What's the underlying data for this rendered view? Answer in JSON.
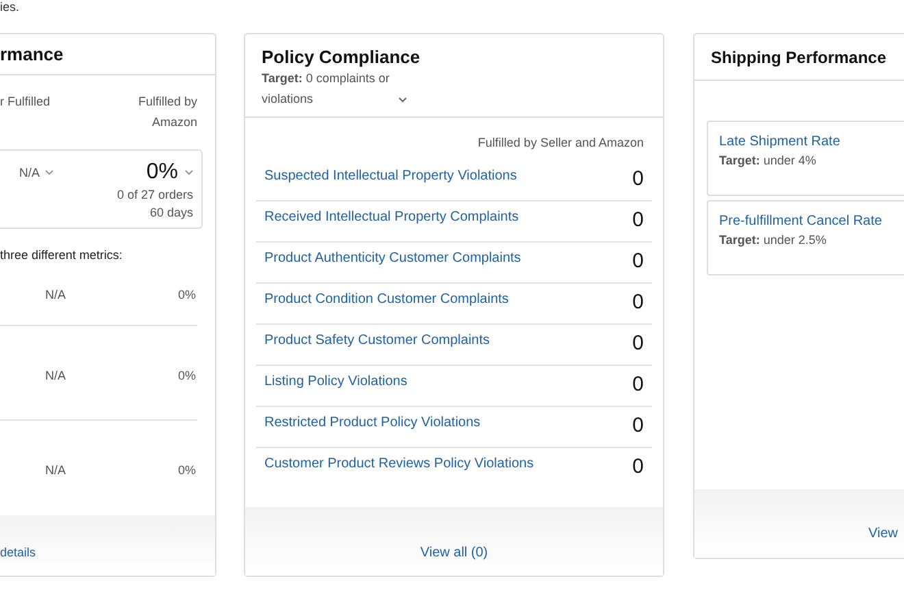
{
  "intro_text": "ies.",
  "fulfillment_card": {
    "title": "rmance",
    "columns": [
      "r Fulfilled",
      "Fulfilled by Amazon"
    ],
    "summary": {
      "seller_value": "N/A",
      "amazon_value": "0%",
      "orders": "0 of 27 orders",
      "period": "60 days"
    },
    "note": "three different metrics:",
    "rows": [
      {
        "seller_value": "N/A",
        "amazon_value": "0%"
      },
      {
        "seller_value": "N/A",
        "amazon_value": "0%"
      },
      {
        "seller_value": "N/A",
        "amazon_value": "0%"
      }
    ],
    "footer_link": "details"
  },
  "policy_card": {
    "title": "Policy Compliance",
    "target": "**Target:** 0 complaints or violations",
    "column": "Fulfilled by Seller and Amazon",
    "rows": [
      {
        "label": "Suspected Intellectual Property Violations",
        "value": "0"
      },
      {
        "label": "Received Intellectual Property Complaints",
        "value": "0"
      },
      {
        "label": "Product Authenticity Customer Complaints",
        "value": "0"
      },
      {
        "label": "Product Condition Customer Complaints",
        "value": "0"
      },
      {
        "label": "Product Safety Customer Complaints",
        "value": "0"
      },
      {
        "label": "Listing Policy Violations",
        "value": "0"
      },
      {
        "label": "Restricted Product Policy Violations",
        "value": "0"
      },
      {
        "label": "Customer Product Reviews Policy Violations",
        "value": "0"
      }
    ],
    "footer_link": "View all (0)"
  },
  "shipping_card": {
    "title": "Shipping Performance",
    "metrics": [
      {
        "label": "Late Shipment Rate",
        "target": "**Target:** under 4%"
      },
      {
        "label": "Pre-fulfillment Cancel Rate",
        "target": "**Target:** under 2.5%"
      }
    ],
    "footer_link": "View"
  }
}
